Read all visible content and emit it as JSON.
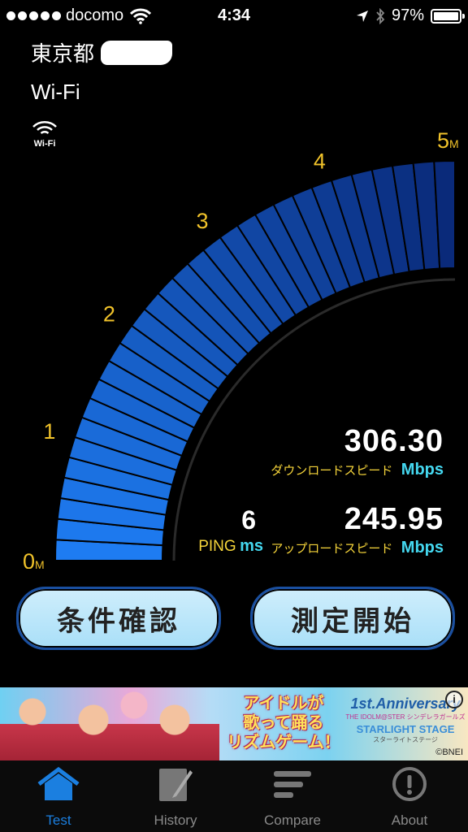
{
  "status_bar": {
    "carrier": "docomo",
    "time": "4:34",
    "battery": "97%"
  },
  "location": "東京都",
  "network": {
    "name": "Wi-Fi",
    "badge": "Wi-Fi"
  },
  "gauge": {
    "scale_labels": [
      "0",
      "1",
      "2",
      "3",
      "4",
      "5"
    ],
    "scale_unit": "M",
    "max": 5,
    "fill_fraction": 1.0,
    "colors": {
      "light": "#1e7cf2",
      "dark": "#0a2a7a",
      "tick": "#f0c22a"
    }
  },
  "download": {
    "value": "306.30",
    "label": "ダウンロードスピード",
    "unit": "Mbps"
  },
  "upload": {
    "value": "245.95",
    "label": "アップロードスピード",
    "unit": "Mbps"
  },
  "ping": {
    "value": "6",
    "label": "PING",
    "unit": "ms"
  },
  "buttons": {
    "conditions": "条件確認",
    "start": "測定開始"
  },
  "ad": {
    "catch": [
      "アイドルが",
      "歌って踊る",
      "リズムゲーム！"
    ],
    "anniversary": "1st.Anniversary",
    "subtitle": "THE IDOLM@STER シンデレラガールズ",
    "stage": "STARLIGHT STAGE",
    "stage_kana": "スターライトステージ",
    "copyright": "©BNEI",
    "info": "i"
  },
  "tabs": [
    {
      "label": "Test",
      "icon": "home-icon",
      "active": true
    },
    {
      "label": "History",
      "icon": "note-icon",
      "active": false
    },
    {
      "label": "Compare",
      "icon": "bars-icon",
      "active": false
    },
    {
      "label": "About",
      "icon": "info-icon",
      "active": false
    }
  ],
  "accent": "#1b7fe0"
}
